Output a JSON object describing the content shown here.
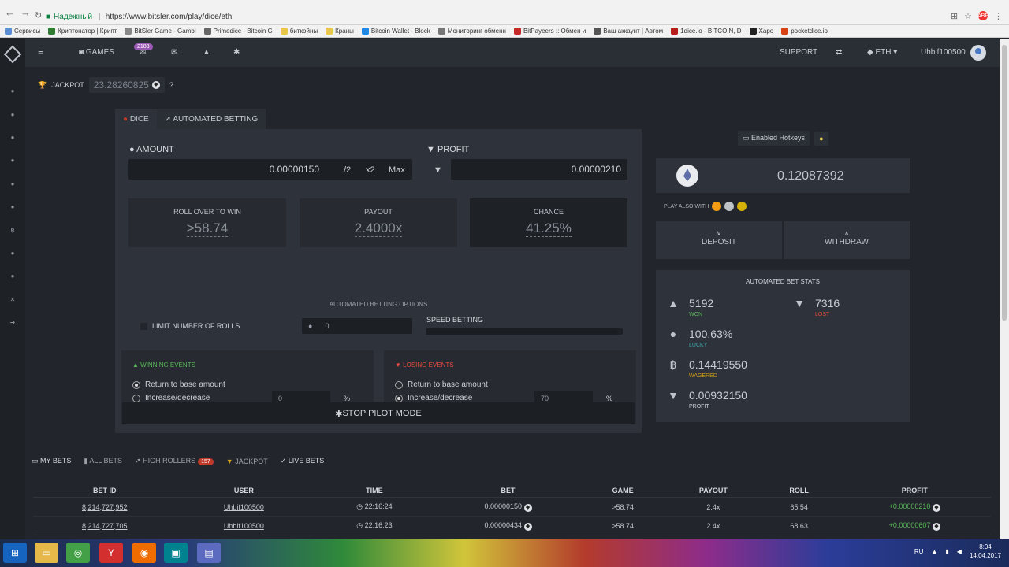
{
  "browser": {
    "secure_label": "Надежный",
    "url": "https://www.bitsler.com/play/dice/eth",
    "bookmarks": [
      "Сервисы",
      "Криптонатор | Крипт",
      "BitSler Game - Gambl",
      "Primedice - Bitcoin G",
      "биткойны",
      "Краны",
      "Bitcoin Wallet - Block",
      "Мониторинг обменн",
      "BitPayeers :: Обмен и",
      "Ваш аккаунт | Автом",
      "1dice.io - BITCOIN, D",
      "Xapo",
      "pocketdice.io"
    ]
  },
  "topbar": {
    "games_label": "GAMES",
    "chat_badge": "2183",
    "support_label": "SUPPORT",
    "currency_label": "ETH",
    "username": "Uhbif100500"
  },
  "jackpot": {
    "label": "JACKPOT",
    "value": "23.28260825",
    "help": "?"
  },
  "tabs": {
    "dice": "DICE",
    "auto": "AUTOMATED BETTING"
  },
  "bet": {
    "amount_label": "AMOUNT",
    "amount_value": "0.00000150",
    "half": "/2",
    "double": "x2",
    "max": "Max",
    "profit_label": "PROFIT",
    "profit_value": "0.00000210"
  },
  "stats_boxes": {
    "roll_label": "ROLL OVER TO WIN",
    "roll_value": ">58.74",
    "payout_label": "PAYOUT",
    "payout_value": "2.4000x",
    "chance_label": "CHANCE",
    "chance_value": "41.25%"
  },
  "auto": {
    "options_title": "AUTOMATED BETTING OPTIONS",
    "limit_label": "LIMIT NUMBER OF ROLLS",
    "limit_value": "0",
    "speed_label": "SPEED BETTING",
    "speed_fraction": 0.97,
    "winning_title": "WINNING EVENTS",
    "losing_title": "LOSING EVENTS",
    "return_label": "Return to base amount",
    "increase_label": "Increase/decrease",
    "win_value": "0",
    "lose_value": "70",
    "percent": "%",
    "stop_label": "STOP PILOT MODE"
  },
  "right": {
    "hotkeys_label": "Enabled Hotkeys",
    "balance": "0.12087392",
    "play_also": "PLAY ALSO WITH",
    "deposit": "DEPOSIT",
    "withdraw": "WITHDRAW",
    "stats_title": "AUTOMATED BET STATS",
    "won_value": "5192",
    "won_label": "WON",
    "lost_value": "7316",
    "lost_label": "LOST",
    "lucky_value": "100.63%",
    "lucky_label": "LUCKY",
    "wagered_value": "0.14419550",
    "wagered_label": "WAGERED",
    "profit_value": "0.00932150",
    "profit_label": "PROFIT"
  },
  "bets_tabs": {
    "my": "MY BETS",
    "all": "ALL BETS",
    "high": "HIGH ROLLERS",
    "high_badge": "157",
    "jackpot": "JACKPOT",
    "live": "LIVE BETS"
  },
  "table": {
    "headers": [
      "BET ID",
      "USER",
      "TIME",
      "BET",
      "GAME",
      "PAYOUT",
      "ROLL",
      "PROFIT"
    ],
    "rows": [
      [
        "8,214,727,952",
        "Uhbif100500",
        "22:16:24",
        "0.00000150",
        ">58.74",
        "2.4x",
        "65.54",
        "+0.00000210"
      ],
      [
        "8,214,727,705",
        "Uhbif100500",
        "22:16:23",
        "0.00000434",
        ">58.74",
        "2.4x",
        "68.63",
        "+0.00000607"
      ]
    ]
  },
  "taskbar": {
    "lang": "RU",
    "time": "8:04",
    "date": "14.04.2017"
  },
  "colors": {
    "green": "#5bb75b",
    "red": "#e74c3c",
    "gold": "#d4a017",
    "accent": "#9b59b6"
  }
}
